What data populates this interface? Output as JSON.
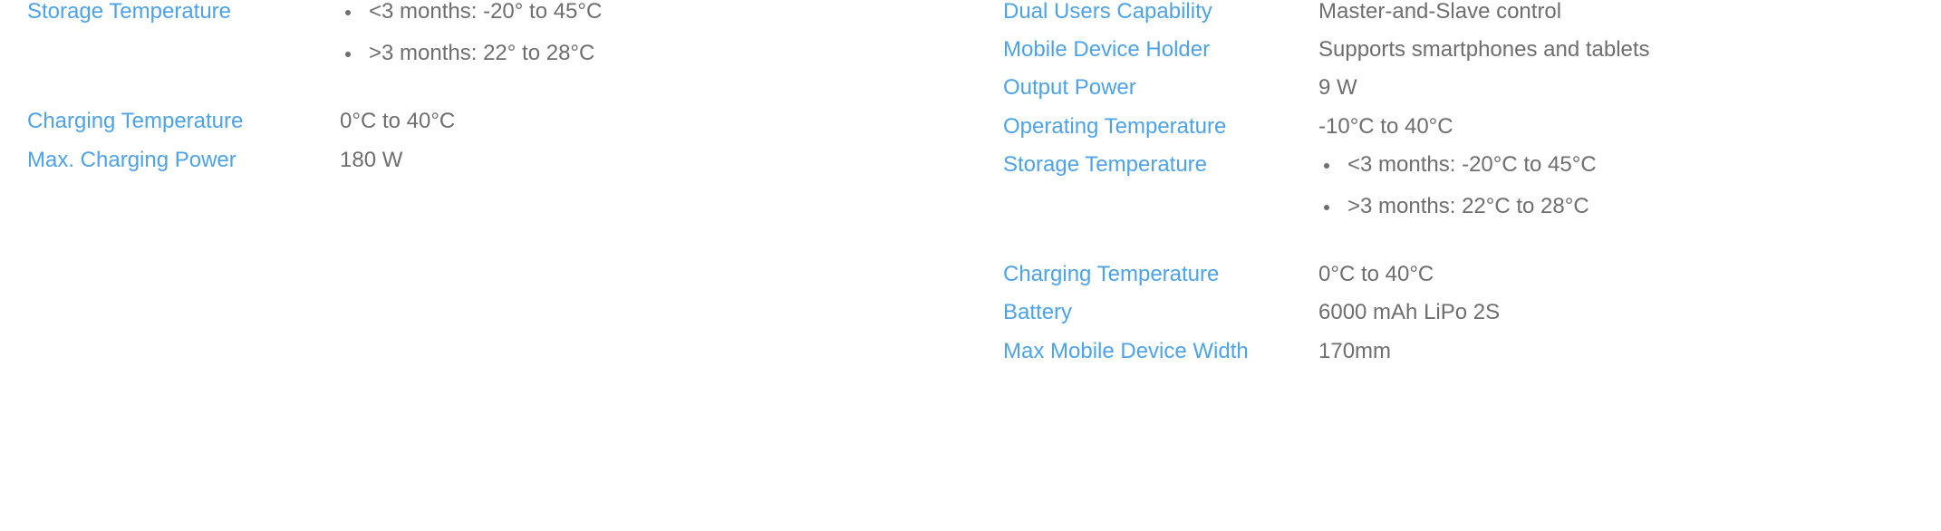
{
  "colors": {
    "label": "#4da2e8",
    "value": "#6e6e6e",
    "background": "#ffffff"
  },
  "left_column": {
    "rows": [
      {
        "label": "Storage Temperature",
        "value_type": "list",
        "values": [
          "<3 months: -20° to 45°C",
          ">3 months: 22° to 28°C"
        ]
      },
      {
        "label": "Charging Temperature",
        "value_type": "text",
        "value": "0°C to 40°C"
      },
      {
        "label": "Max. Charging Power",
        "value_type": "text",
        "value": "180 W"
      }
    ]
  },
  "right_column": {
    "rows": [
      {
        "label": "Dual Users Capability",
        "value_type": "text",
        "value": "Master-and-Slave control"
      },
      {
        "label": "Mobile Device Holder",
        "value_type": "text",
        "value": "Supports smartphones and tablets"
      },
      {
        "label": "Output Power",
        "value_type": "text",
        "value": "9 W"
      },
      {
        "label": "Operating Temperature",
        "value_type": "text",
        "value": "-10°C to 40°C"
      },
      {
        "label": "Storage Temperature",
        "value_type": "list",
        "values": [
          "<3 months: -20°C to 45°C",
          ">3 months: 22°C to 28°C"
        ]
      },
      {
        "label": "Charging Temperature",
        "value_type": "text",
        "value": "0°C to 40°C"
      },
      {
        "label": "Battery",
        "value_type": "text",
        "value": "6000 mAh LiPo 2S"
      },
      {
        "label": "Max Mobile Device Width",
        "value_type": "text",
        "value": "170mm"
      }
    ]
  }
}
